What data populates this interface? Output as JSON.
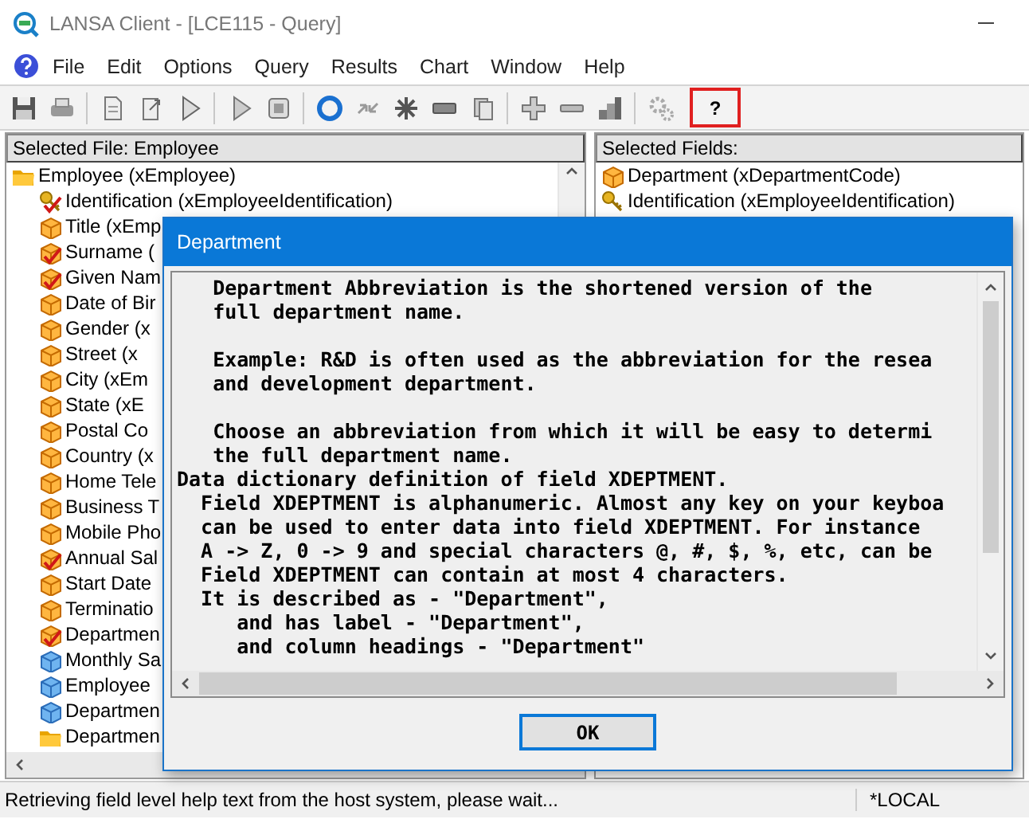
{
  "window": {
    "title": "LANSA Client - [LCE115 - Query]"
  },
  "menu": [
    "File",
    "Edit",
    "Options",
    "Query",
    "Results",
    "Chart",
    "Window",
    "Help"
  ],
  "toolbar": {
    "help_button": {
      "label": "?",
      "highlighted": true
    }
  },
  "selected_file": {
    "header": "Selected File: Employee",
    "tree": {
      "label": "Employee (xEmployee)",
      "kind": "folder",
      "children": [
        {
          "label": "Identification (xEmployeeIdentification)",
          "kind": "key",
          "selected": true
        },
        {
          "label": "Title (xEmp",
          "kind": "field",
          "selected": false
        },
        {
          "label": "Surname (",
          "kind": "field",
          "selected": true
        },
        {
          "label": "Given Nam",
          "kind": "field",
          "selected": true
        },
        {
          "label": "Date of Bir",
          "kind": "field",
          "selected": false
        },
        {
          "label": "Gender (x",
          "kind": "field",
          "selected": false
        },
        {
          "label": "Street (x",
          "kind": "field",
          "selected": false
        },
        {
          "label": "City (xEm",
          "kind": "field",
          "selected": false
        },
        {
          "label": "State (xE",
          "kind": "field",
          "selected": false
        },
        {
          "label": "Postal Co",
          "kind": "field",
          "selected": false
        },
        {
          "label": "Country (x",
          "kind": "field",
          "selected": false
        },
        {
          "label": "Home Tele",
          "kind": "field",
          "selected": false
        },
        {
          "label": "Business T",
          "kind": "field",
          "selected": false
        },
        {
          "label": "Mobile Pho",
          "kind": "field",
          "selected": false
        },
        {
          "label": "Annual Sal",
          "kind": "field",
          "selected": true
        },
        {
          "label": "Start Date",
          "kind": "field",
          "selected": false
        },
        {
          "label": "Terminatio",
          "kind": "field",
          "selected": false
        },
        {
          "label": "Departmen",
          "kind": "field",
          "selected": true
        },
        {
          "label": "Monthly Sa",
          "kind": "virtual",
          "selected": false
        },
        {
          "label": "Employee",
          "kind": "virtual",
          "selected": false
        },
        {
          "label": "Departmen",
          "kind": "virtual",
          "selected": false
        },
        {
          "label": "Departmen",
          "kind": "folder",
          "selected": false
        }
      ]
    }
  },
  "selected_fields": {
    "header": "Selected Fields:",
    "items": [
      {
        "label": "Department (xDepartmentCode)",
        "kind": "field"
      },
      {
        "label": "Identification (xEmployeeIdentification)",
        "kind": "key"
      }
    ]
  },
  "dialog": {
    "title": "Department",
    "paragraphs": [
      {
        "lines": [
          "   Department Abbreviation is the shortened version of the",
          "   full department name."
        ]
      },
      {
        "lines": [
          "   Example: R&D is often used as the abbreviation for the resea",
          "   and development department."
        ]
      },
      {
        "lines": [
          "   Choose an abbreviation from which it will be easy to determi",
          "   the full department name.",
          "Data dictionary definition of field XDEPTMENT.",
          "  Field XDEPTMENT is alphanumeric. Almost any key on your keyboa",
          "  can be used to enter data into field XDEPTMENT. For instance",
          "  A -> Z, 0 -> 9 and special characters @, #, $, %, etc, can be",
          "  Field XDEPTMENT can contain at most 4 characters.",
          "  It is described as - \"Department\",",
          "     and has label - \"Department\",",
          "     and column headings - \"Department\""
        ]
      }
    ],
    "ok_button": "OK"
  },
  "status_bar": {
    "message": "Retrieving field level help text from the host system, please wait...",
    "location": "*LOCAL"
  }
}
